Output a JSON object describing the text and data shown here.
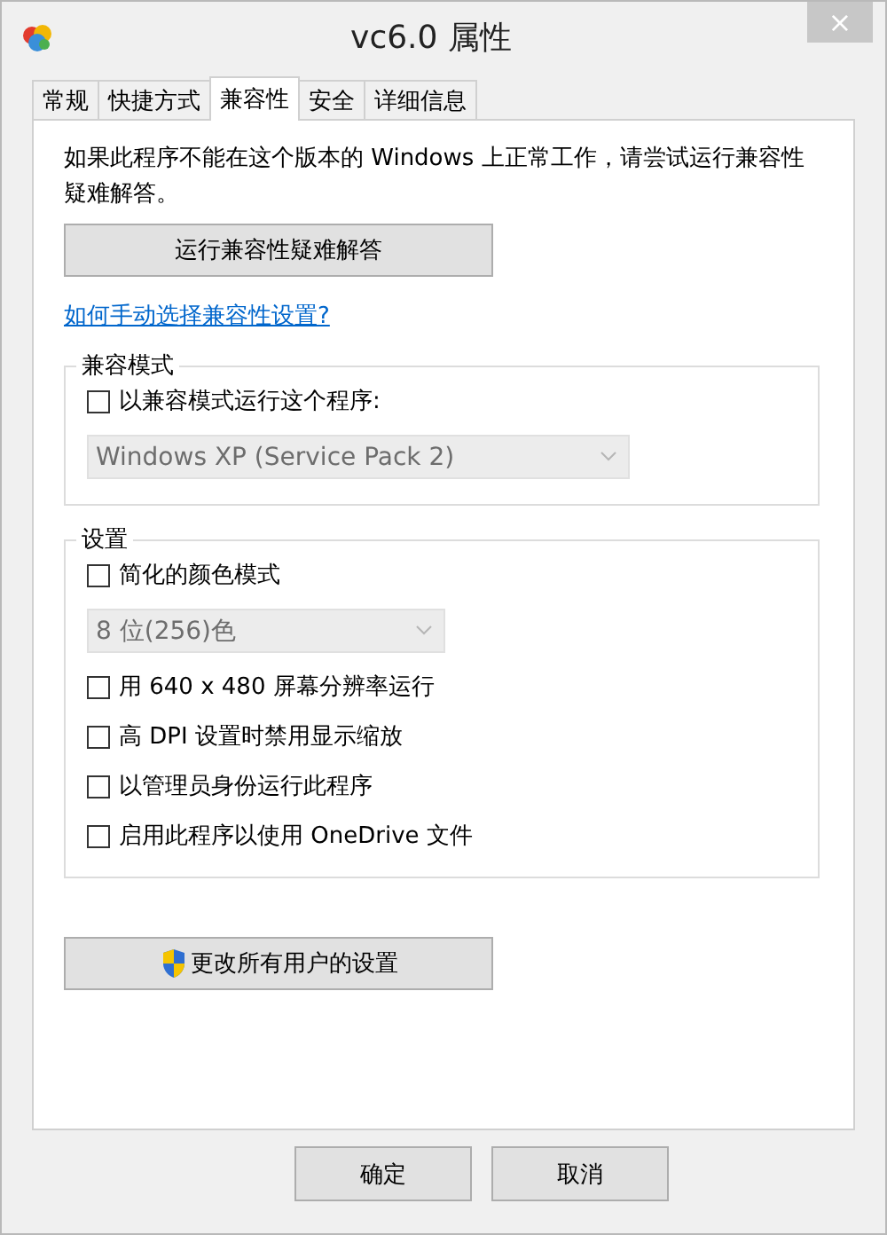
{
  "window": {
    "title": "vc6.0 属性",
    "close": "×"
  },
  "tabs": [
    {
      "label": "常规",
      "selected": false
    },
    {
      "label": "快捷方式",
      "selected": false
    },
    {
      "label": "兼容性",
      "selected": true
    },
    {
      "label": "安全",
      "selected": false
    },
    {
      "label": "详细信息",
      "selected": false
    }
  ],
  "description": "如果此程序不能在这个版本的 Windows 上正常工作，请尝试运行兼容性疑难解答。",
  "troubleshoot_button": "运行兼容性疑难解答",
  "help_link": "如何手动选择兼容性设置?",
  "compat_group": {
    "title": "兼容模式",
    "items": [
      {
        "kind": "checkbox",
        "label": "以兼容模式运行这个程序:",
        "checked": false
      },
      {
        "kind": "dropdown",
        "value": "Windows XP (Service Pack 2)",
        "disabled": true
      }
    ]
  },
  "settings_group": {
    "title": "设置",
    "items": [
      {
        "kind": "checkbox",
        "label": "简化的颜色模式",
        "checked": false
      },
      {
        "kind": "dropdown",
        "value": "8 位(256)色",
        "disabled": true
      },
      {
        "kind": "checkbox",
        "label": "用 640 x 480 屏幕分辨率运行",
        "checked": false
      },
      {
        "kind": "checkbox",
        "label": "高 DPI 设置时禁用显示缩放",
        "checked": false
      },
      {
        "kind": "checkbox",
        "label": "以管理员身份运行此程序",
        "checked": false
      },
      {
        "kind": "checkbox",
        "label": "启用此程序以使用 OneDrive 文件",
        "checked": false
      }
    ]
  },
  "all_users_button": "更改所有用户的设置",
  "buttons": [
    "确定",
    "取消"
  ]
}
